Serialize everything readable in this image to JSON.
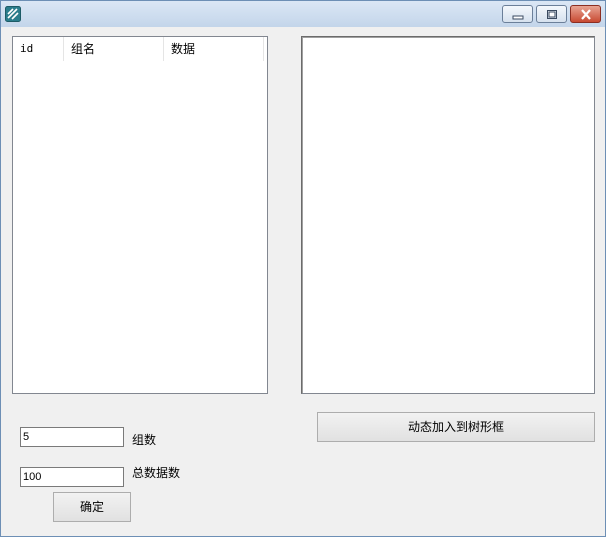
{
  "window": {
    "icon": "app-icon",
    "controls": {
      "minimize": "minimize-icon",
      "maximize": "maximize-icon",
      "close": "close-icon"
    }
  },
  "listview": {
    "columns": [
      "id",
      "组名",
      "数据"
    ],
    "rows": []
  },
  "treeview": {
    "items": []
  },
  "controls": {
    "add_to_tree_button": "动态加入到树形框",
    "groups_value": "5",
    "groups_label": "组数",
    "total_value": "100",
    "total_label": "总数据数",
    "ok_button": "确定"
  }
}
